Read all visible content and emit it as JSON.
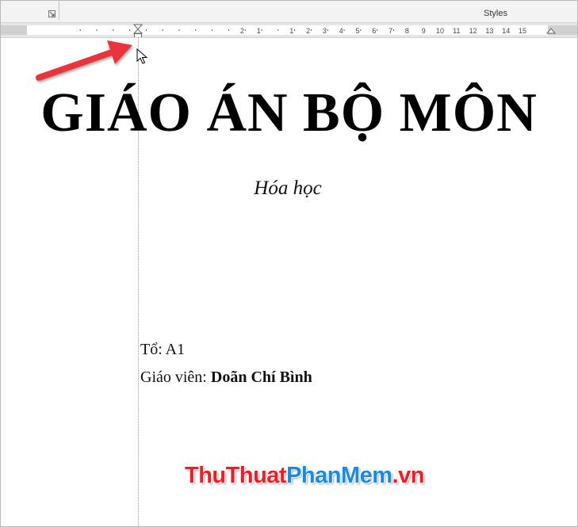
{
  "ribbon": {
    "styles_label": "Styles",
    "launcher_icon": "dialog-launcher-icon"
  },
  "ruler": {
    "numbers": [
      "2",
      "1",
      "1",
      "2",
      "3",
      "4",
      "5",
      "6",
      "7",
      "8",
      "9",
      "10",
      "11",
      "12",
      "13",
      "14",
      "15"
    ],
    "first_line_indent_marker": "hourglass-indent-marker-icon",
    "right_indent_marker": "right-indent-marker-icon"
  },
  "document": {
    "title": "GIÁO ÁN BỘ MÔN",
    "subtitle": "Hóa học",
    "group_label": "Tổ: A1",
    "teacher_prefix": "Giáo viên: ",
    "teacher_name": "Doãn Chí Bình"
  },
  "watermark": {
    "part1": "ThuThuat",
    "part2": "PhanMem",
    "part3": ".vn"
  },
  "annotations": {
    "arrow_icon": "red-arrow-icon",
    "cursor_icon": "mouse-pointer-icon",
    "arrow_color": "#e8343b"
  }
}
